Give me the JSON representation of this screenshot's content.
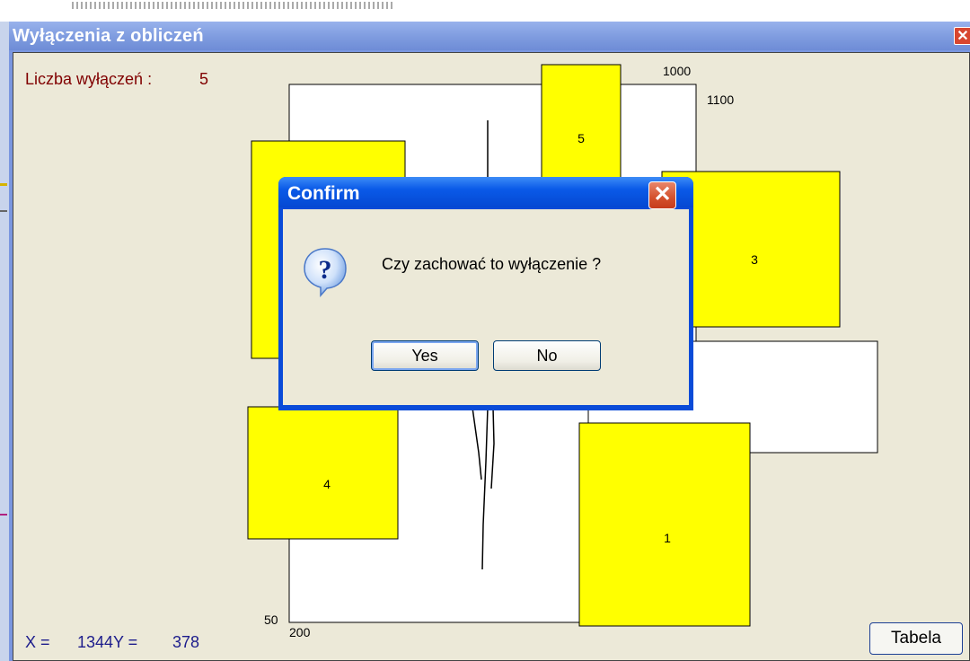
{
  "window": {
    "title": "Wyłączenia z obliczeń",
    "close_glyph": "✕",
    "count_label": "Liczba wyłączeń :",
    "count_value": "5",
    "coord_x_label": "X =",
    "coord_x_value": "1344",
    "coord_y_label": "Y =",
    "coord_y_value": "378",
    "table_button": "Tabela"
  },
  "plot": {
    "labels": {
      "top_1000": "1000",
      "top_1100": "1100",
      "bottom_50": "50",
      "bottom_200": "200"
    },
    "exclusions": [
      "5",
      "3",
      "4",
      "1"
    ],
    "colors": {
      "exclusion_fill": "#ffff00",
      "area_fill": "#ffffff",
      "outline": "#000000"
    }
  },
  "dialog": {
    "title": "Confirm",
    "message": "Czy zachować to wyłączenie ?",
    "yes_label": "Yes",
    "no_label": "No",
    "icon": "question-icon",
    "close_glyph": "✕"
  },
  "colors": {
    "title_bar": "#7e9bdf",
    "dialog_title": "#0a5ae8",
    "client_bg": "#ece9d8",
    "count_text": "#800000",
    "coord_text": "#1c1c8c"
  }
}
